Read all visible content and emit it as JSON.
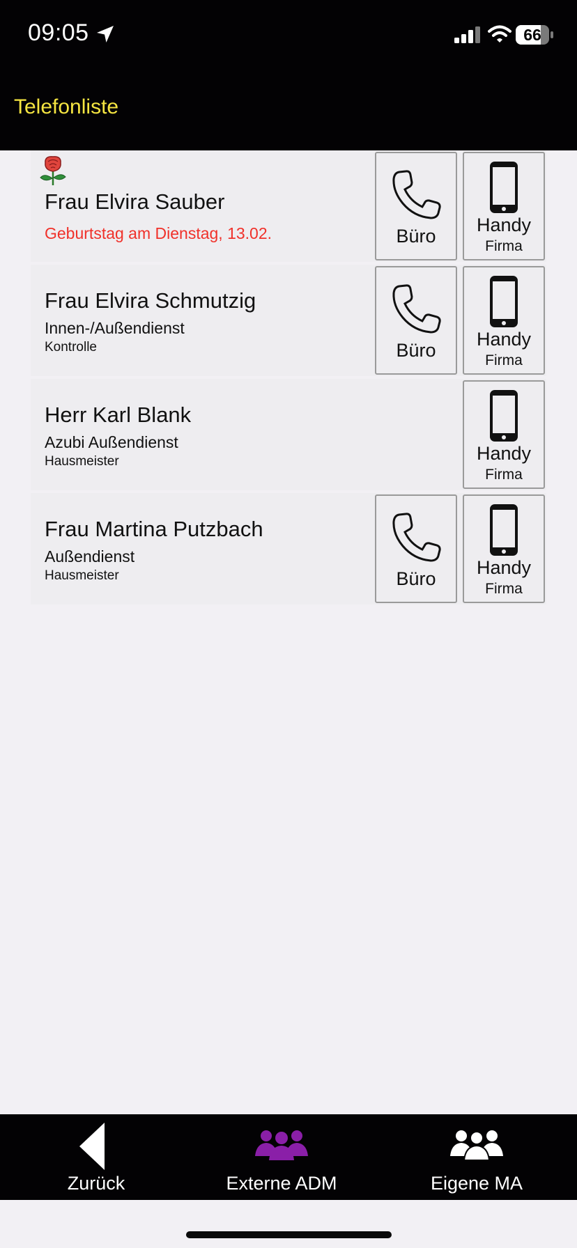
{
  "status_bar": {
    "time": "09:05",
    "battery_level": "66",
    "icons": [
      "location-arrow-icon",
      "signal-icon",
      "wifi-icon",
      "battery-icon"
    ]
  },
  "nav": {
    "title": "Telefonliste",
    "title_color": "#f5e541"
  },
  "contacts": [
    {
      "name": "Frau Elvira Sauber",
      "line2": "Geburtstag am Dienstag, 13.02.",
      "line2_is_birthday": true,
      "line3": "",
      "has_birthday_icon": true,
      "office_label": "Büro",
      "mobile_label": "Handy",
      "mobile_sub": "Firma"
    },
    {
      "name": "Frau Elvira Schmutzig",
      "line2": "Innen-/Außendienst",
      "line3": "Kontrolle",
      "office_label": "Büro",
      "mobile_label": "Handy",
      "mobile_sub": "Firma"
    },
    {
      "name": "Herr Karl Blank",
      "line2": "Azubi Außendienst",
      "line3": "Hausmeister",
      "mobile_label": "Handy",
      "mobile_sub": "Firma"
    },
    {
      "name": "Frau Martina Putzbach",
      "line2": "Außendienst",
      "line3": "Hausmeister",
      "office_label": "Büro",
      "mobile_label": "Handy",
      "mobile_sub": "Firma"
    }
  ],
  "tabs": [
    {
      "label": "Zurück",
      "icon": "back-triangle-icon"
    },
    {
      "label": "Externe ADM",
      "icon": "group-icon",
      "color": "#8a1fa8",
      "active": true
    },
    {
      "label": "Eigene MA",
      "icon": "group-icon",
      "color": "#ffffff"
    }
  ],
  "colors": {
    "bars": "#030204",
    "background": "#f2f0f4",
    "row": "#eeedf0",
    "birthday_text": "#f0312a"
  }
}
